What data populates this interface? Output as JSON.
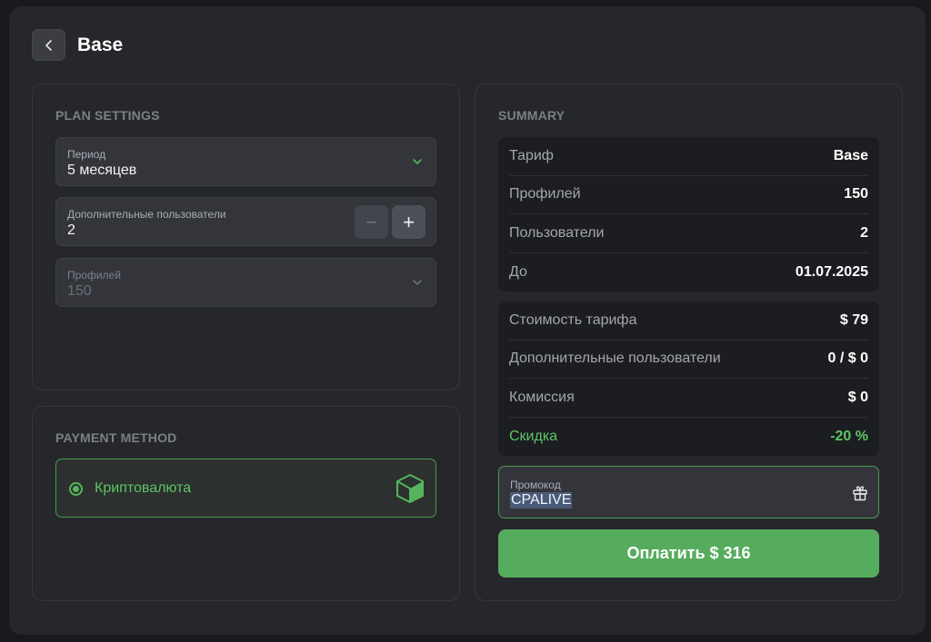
{
  "header": {
    "title": "Base",
    "back_icon": "chevron-left-icon"
  },
  "plan_settings": {
    "label": "PLAN SETTINGS",
    "period": {
      "label": "Период",
      "value": "5 месяцев"
    },
    "extra_users": {
      "label": "Дополнительные пользователи",
      "value": "2",
      "minus": "−",
      "plus": "+"
    },
    "profiles": {
      "label": "Профилей",
      "value": "150"
    }
  },
  "payment_method": {
    "label": "PAYMENT METHOD",
    "option": {
      "label": "Криптовалюта",
      "icon": "cube-icon",
      "selected": true
    }
  },
  "summary": {
    "label": "SUMMARY",
    "details": [
      {
        "key": "Тариф",
        "value": "Base"
      },
      {
        "key": "Профилей",
        "value": "150"
      },
      {
        "key": "Пользователи",
        "value": "2"
      },
      {
        "key": "До",
        "value": "01.07.2025"
      }
    ],
    "costs": [
      {
        "key": "Стоимость тарифа",
        "value": "$ 79"
      },
      {
        "key": "Дополнительные пользователи",
        "value": "0 / $ 0"
      },
      {
        "key": "Комиссия",
        "value": "$ 0"
      },
      {
        "key": "Скидка",
        "value": "-20 %"
      }
    ],
    "promo": {
      "label": "Промокод",
      "value": "CPALIVE",
      "icon": "gift-icon"
    },
    "pay_button": "Оплатить $ 316"
  },
  "colors": {
    "accent": "#56ac5e",
    "accent_text": "#5cc565",
    "background": "#26272b"
  }
}
